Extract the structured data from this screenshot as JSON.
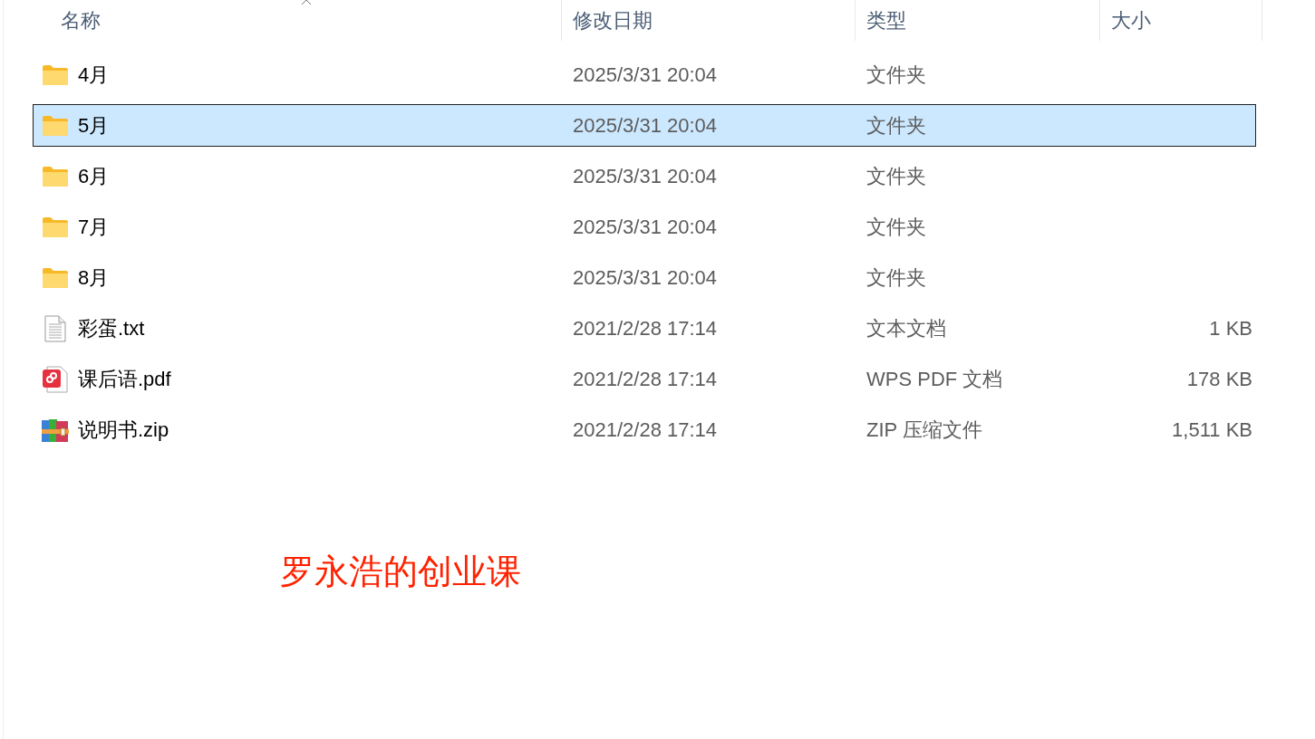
{
  "columns": [
    "名称",
    "修改日期",
    "类型",
    "大小"
  ],
  "rows": [
    {
      "kind": "folder",
      "name": "4月",
      "modified": "2025/3/31 20:04",
      "type": "文件夹",
      "selected": false
    },
    {
      "kind": "folder",
      "name": "5月",
      "modified": "2025/3/31 20:04",
      "type": "文件夹",
      "selected": true
    },
    {
      "kind": "folder",
      "name": "6月",
      "modified": "2025/3/31 20:04",
      "type": "文件夹",
      "selected": false
    },
    {
      "kind": "folder",
      "name": "7月",
      "modified": "2025/3/31 20:04",
      "type": "文件夹",
      "selected": false
    },
    {
      "kind": "folder",
      "name": "8月",
      "modified": "2025/3/31 20:04",
      "type": "文件夹",
      "selected": false
    },
    {
      "kind": "text",
      "name": "彩蛋.txt",
      "modified": "2021/2/28 17:14",
      "type": "文本文档",
      "size": "1 KB",
      "selected": false
    },
    {
      "kind": "pdf",
      "name": "课后语.pdf",
      "modified": "2021/2/28 17:14",
      "type": "WPS PDF 文档",
      "size": "178 KB",
      "selected": false
    },
    {
      "kind": "archive",
      "name": "说明书.zip",
      "modified": "2021/2/28 17:14",
      "type": "ZIP 压缩文件",
      "size": "1,511 KB",
      "selected": false
    }
  ],
  "overlay_text": "罗永浩的创业课"
}
